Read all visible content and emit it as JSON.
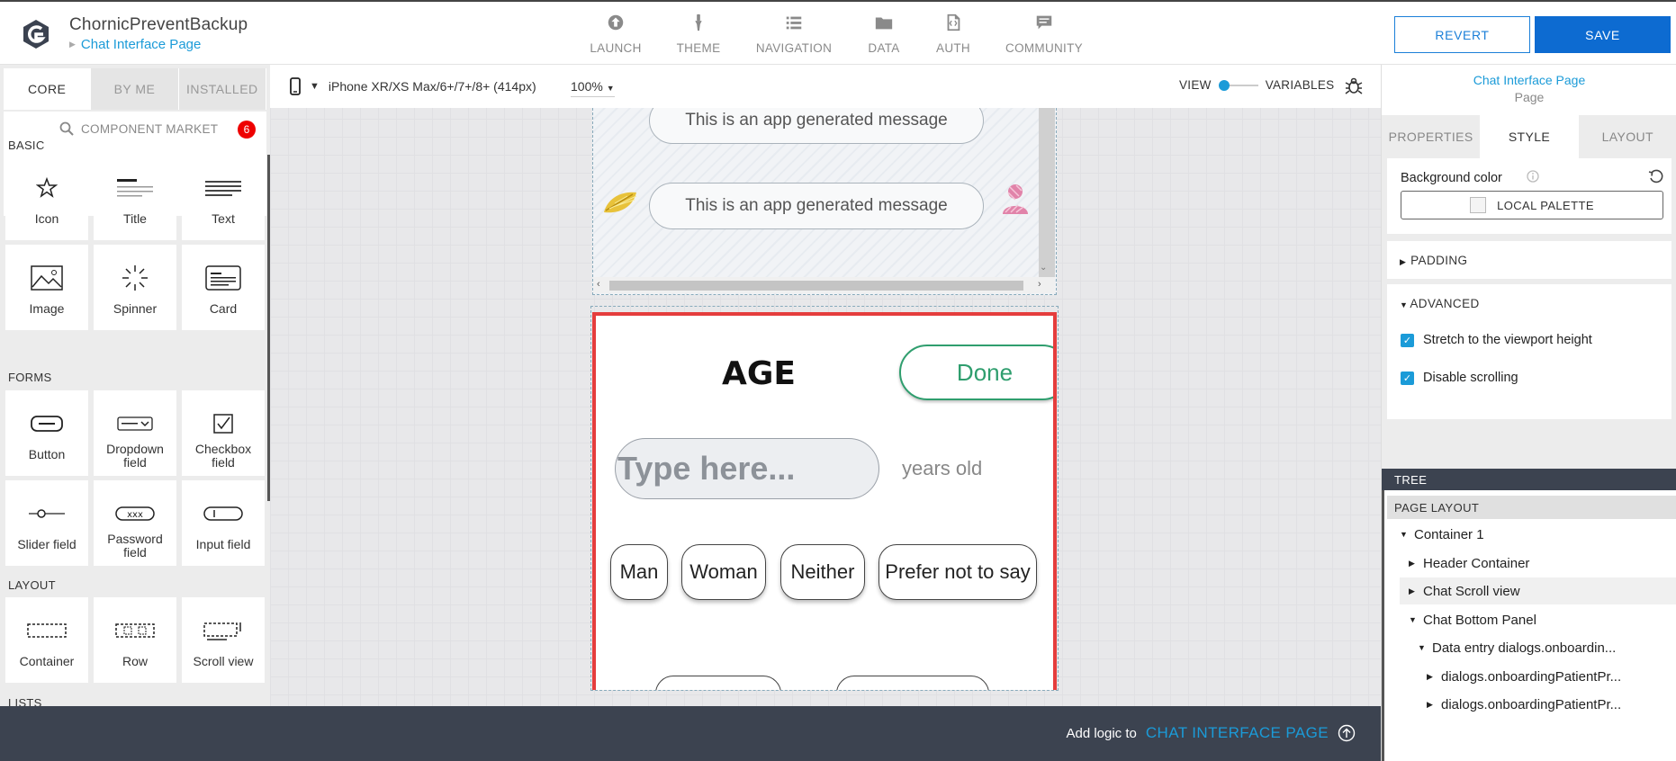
{
  "app": {
    "name": "ChornicPreventBackup",
    "page_crumb": "Chat Interface Page"
  },
  "nav": [
    {
      "label": "LAUNCH",
      "icon": "launch-icon"
    },
    {
      "label": "THEME",
      "icon": "theme-brush-icon"
    },
    {
      "label": "NAVIGATION",
      "icon": "navigation-list-icon"
    },
    {
      "label": "DATA",
      "icon": "data-folder-icon"
    },
    {
      "label": "AUTH",
      "icon": "auth-file-icon"
    },
    {
      "label": "COMMUNITY",
      "icon": "community-chat-icon"
    }
  ],
  "actions": {
    "revert": "REVERT",
    "save": "SAVE"
  },
  "left": {
    "tabs": [
      "CORE",
      "BY ME",
      "INSTALLED"
    ],
    "market": "COMPONENT MARKET",
    "market_count": "6",
    "sections": {
      "basic": "BASIC",
      "forms": "FORMS",
      "layout": "LAYOUT",
      "lists": "LISTS"
    },
    "basic": [
      "Icon",
      "Title",
      "Text",
      "Image",
      "Spinner",
      "Card"
    ],
    "forms": [
      "Button",
      "Dropdown field",
      "Checkbox field",
      "Slider field",
      "Password field",
      "Input field"
    ],
    "layout": [
      "Container",
      "Row",
      "Scroll view"
    ]
  },
  "canvas": {
    "device": "iPhone XR/XS Max/6+/7+/8+ (414px)",
    "zoom": "100%",
    "view": "VIEW",
    "variables": "VARIABLES",
    "messages": [
      "This is an app generated message",
      "This is an app generated message"
    ],
    "age_title": "AGE",
    "done": "Done",
    "input_placeholder": "Type here...",
    "unit": "years old",
    "gender_options": [
      "Man",
      "Woman",
      "Neither",
      "Prefer not to say"
    ]
  },
  "logic": {
    "prefix": "Add logic to",
    "target": "CHAT INTERFACE PAGE"
  },
  "right": {
    "title": "Chat Interface Page",
    "subtitle": "Page",
    "tabs": [
      "PROPERTIES",
      "STYLE",
      "LAYOUT"
    ],
    "bg_label": "Background color",
    "palette": "LOCAL PALETTE",
    "padding": "PADDING",
    "advanced": "ADVANCED",
    "stretch": "Stretch to the viewport height",
    "disable_scroll": "Disable scrolling",
    "tree": "TREE",
    "page_layout": "PAGE LAYOUT",
    "nodes": [
      "Container 1",
      "Header Container",
      "Chat Scroll view",
      "Chat Bottom Panel",
      "Data entry dialogs.onboardin...",
      "dialogs.onboardingPatientPr...",
      "dialogs.onboardingPatientPr..."
    ]
  },
  "colors": {
    "accent": "#1b9bd8",
    "save": "#0d6bd1",
    "selection": "#e53d3d",
    "done": "#2f9e6e",
    "darkbar": "#3c4350"
  }
}
